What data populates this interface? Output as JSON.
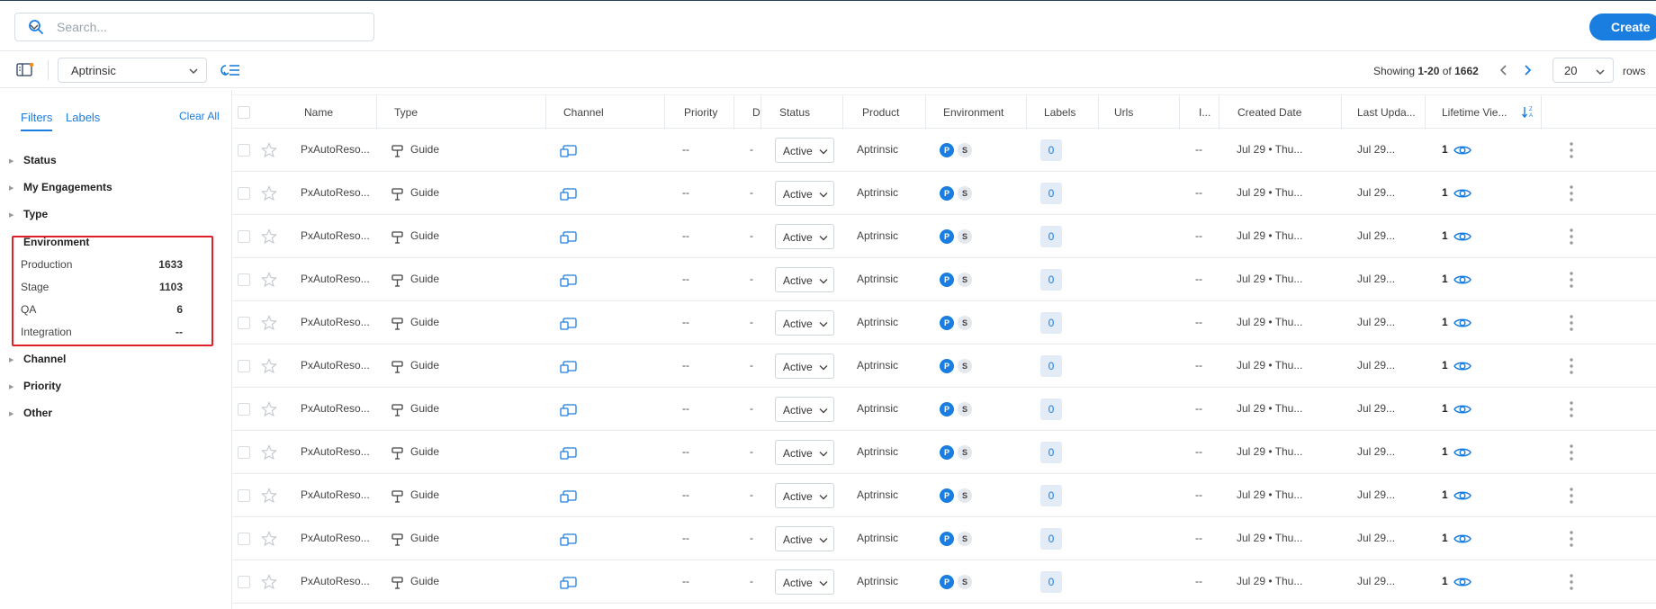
{
  "search": {
    "placeholder": "Search..."
  },
  "header": {
    "create_label": "Create"
  },
  "toolbar": {
    "product_selected": "Aptrinsic",
    "showing_prefix": "Showing ",
    "showing_range": "1-20",
    "showing_of": " of ",
    "showing_total": "1662",
    "rows_per_page": "20",
    "rows_label": "rows"
  },
  "sidebar": {
    "tabs": [
      "Filters",
      "Labels"
    ],
    "clear_all": "Clear All",
    "groups_top": [
      "Status",
      "My Engagements",
      "Type"
    ],
    "environment": {
      "title": "Environment",
      "items": [
        {
          "label": "Production",
          "count": "1633"
        },
        {
          "label": "Stage",
          "count": "1103"
        },
        {
          "label": "QA",
          "count": "6"
        },
        {
          "label": "Integration",
          "count": "--"
        }
      ]
    },
    "groups_bottom": [
      "Channel",
      "Priority",
      "Other"
    ]
  },
  "table": {
    "columns": [
      "Name",
      "Type",
      "Channel",
      "Priority",
      "D",
      "Status",
      "Product",
      "Environment",
      "Labels",
      "Urls",
      "I...",
      "Created Date",
      "Last Upda...",
      "Lifetime Vie..."
    ],
    "rows": [
      {
        "name": "PxAutoReso...",
        "type": "Guide",
        "priority": "--",
        "d": "-",
        "status": "Active",
        "product": "Aptrinsic",
        "env_p": "P",
        "env_s": "S",
        "labels": "0",
        "i": "--",
        "created": "Jul 29 • Thu...",
        "updated": "Jul 29...",
        "views": "1"
      },
      {
        "name": "PxAutoReso...",
        "type": "Guide",
        "priority": "--",
        "d": "-",
        "status": "Active",
        "product": "Aptrinsic",
        "env_p": "P",
        "env_s": "S",
        "labels": "0",
        "i": "--",
        "created": "Jul 29 • Thu...",
        "updated": "Jul 29...",
        "views": "1"
      },
      {
        "name": "PxAutoReso...",
        "type": "Guide",
        "priority": "--",
        "d": "-",
        "status": "Active",
        "product": "Aptrinsic",
        "env_p": "P",
        "env_s": "S",
        "labels": "0",
        "i": "--",
        "created": "Jul 29 • Thu...",
        "updated": "Jul 29...",
        "views": "1"
      },
      {
        "name": "PxAutoReso...",
        "type": "Guide",
        "priority": "--",
        "d": "-",
        "status": "Active",
        "product": "Aptrinsic",
        "env_p": "P",
        "env_s": "S",
        "labels": "0",
        "i": "--",
        "created": "Jul 29 • Thu...",
        "updated": "Jul 29...",
        "views": "1"
      },
      {
        "name": "PxAutoReso...",
        "type": "Guide",
        "priority": "--",
        "d": "-",
        "status": "Active",
        "product": "Aptrinsic",
        "env_p": "P",
        "env_s": "S",
        "labels": "0",
        "i": "--",
        "created": "Jul 29 • Thu...",
        "updated": "Jul 29...",
        "views": "1"
      },
      {
        "name": "PxAutoReso...",
        "type": "Guide",
        "priority": "--",
        "d": "-",
        "status": "Active",
        "product": "Aptrinsic",
        "env_p": "P",
        "env_s": "S",
        "labels": "0",
        "i": "--",
        "created": "Jul 29 • Thu...",
        "updated": "Jul 29...",
        "views": "1"
      },
      {
        "name": "PxAutoReso...",
        "type": "Guide",
        "priority": "--",
        "d": "-",
        "status": "Active",
        "product": "Aptrinsic",
        "env_p": "P",
        "env_s": "S",
        "labels": "0",
        "i": "--",
        "created": "Jul 29 • Thu...",
        "updated": "Jul 29...",
        "views": "1"
      },
      {
        "name": "PxAutoReso...",
        "type": "Guide",
        "priority": "--",
        "d": "-",
        "status": "Active",
        "product": "Aptrinsic",
        "env_p": "P",
        "env_s": "S",
        "labels": "0",
        "i": "--",
        "created": "Jul 29 • Thu...",
        "updated": "Jul 29...",
        "views": "1"
      },
      {
        "name": "PxAutoReso...",
        "type": "Guide",
        "priority": "--",
        "d": "-",
        "status": "Active",
        "product": "Aptrinsic",
        "env_p": "P",
        "env_s": "S",
        "labels": "0",
        "i": "--",
        "created": "Jul 29 • Thu...",
        "updated": "Jul 29...",
        "views": "1"
      },
      {
        "name": "PxAutoReso...",
        "type": "Guide",
        "priority": "--",
        "d": "-",
        "status": "Active",
        "product": "Aptrinsic",
        "env_p": "P",
        "env_s": "S",
        "labels": "0",
        "i": "--",
        "created": "Jul 29 • Thu...",
        "updated": "Jul 29...",
        "views": "1"
      },
      {
        "name": "PxAutoReso...",
        "type": "Guide",
        "priority": "--",
        "d": "-",
        "status": "Active",
        "product": "Aptrinsic",
        "env_p": "P",
        "env_s": "S",
        "labels": "0",
        "i": "--",
        "created": "Jul 29 • Thu...",
        "updated": "Jul 29...",
        "views": "1"
      }
    ]
  },
  "colors": {
    "accent": "#1a7ee0",
    "highlight_box": "#e0202a"
  }
}
